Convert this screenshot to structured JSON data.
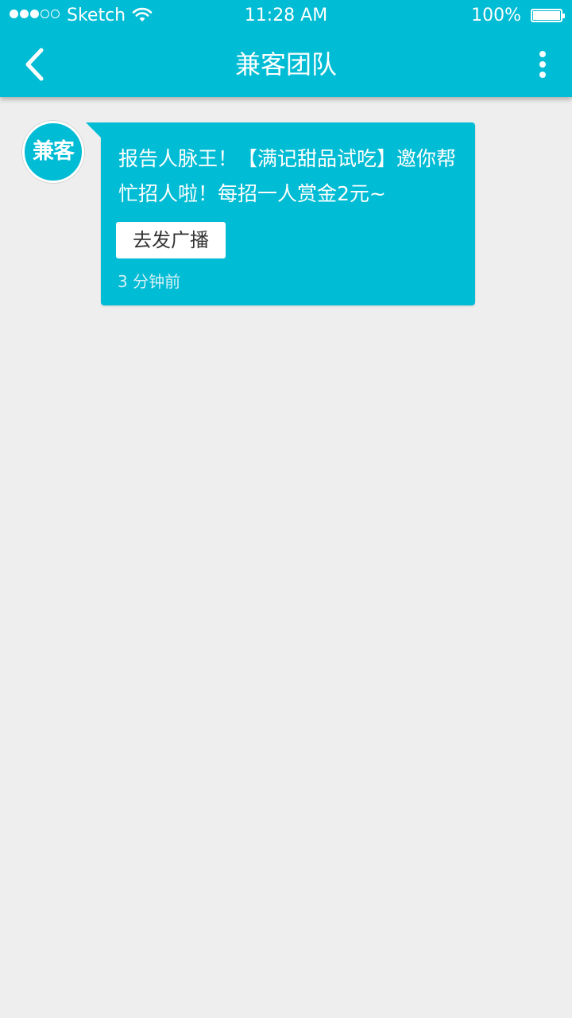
{
  "status_bar": {
    "carrier": "Sketch",
    "time": "11:28 AM",
    "battery": "100%",
    "battery_level": 1.0,
    "signal_bars": 3,
    "signal_max": 5
  },
  "nav": {
    "title": "兼客团队",
    "back_icon": "chevron-left-icon",
    "menu_icon": "more-vertical-icon"
  },
  "message": {
    "avatar_text": "兼客",
    "text": "报告人脉王！【满记甜品试吃】邀你帮忙招人啦！每招一人赏金2元~",
    "action_label": "去发广播",
    "time_ago": "3 分钟前"
  },
  "colors": {
    "accent": "#00bcd4",
    "background": "#eeeeee"
  }
}
